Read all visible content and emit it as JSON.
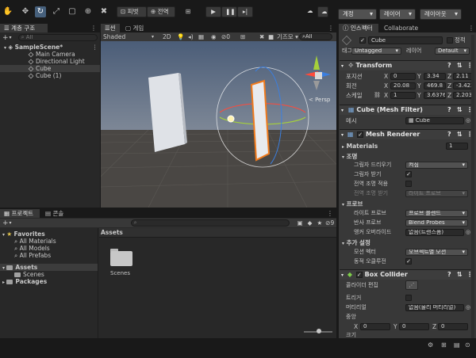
{
  "toolbar": {
    "pause_label": "피벗",
    "global_label": "전역",
    "account_label": "계정",
    "layers_label": "레이어",
    "layout_label": "레이아웃"
  },
  "hierarchy": {
    "tab_label": "계층 구조",
    "search_placeholder": "All",
    "scene_name": "SampleScene*",
    "items": [
      "Main Camera",
      "Directional Light",
      "Cube",
      "Cube (1)"
    ]
  },
  "scene_view": {
    "tab_scene": "씬",
    "tab_game": "게임",
    "shading": "Shaded",
    "mode_2d": "2D",
    "hidden_count": "0",
    "gizmos_label": "기즈모",
    "persp_label": "< Persp"
  },
  "project": {
    "tab_project": "프로젝트",
    "tab_console": "콘솔",
    "hidden_count": "9",
    "favorites_label": "Favorites",
    "favorites": [
      "All Materials",
      "All Models",
      "All Prefabs"
    ],
    "assets_label": "Assets",
    "assets_children": [
      "Scenes"
    ],
    "packages_label": "Packages",
    "breadcrumb": "Assets",
    "folder_name": "Scenes"
  },
  "inspector": {
    "tab_inspector": "인스펙터",
    "tab_collaborate": "Collaborate",
    "object_name": "Cube",
    "static_label": "정적",
    "tag_label": "태그",
    "tag_value": "Untagged",
    "layer_label": "레이어",
    "layer_value": "Default",
    "transform": {
      "title": "Transform",
      "position_label": "포지션",
      "rotation_label": "회전",
      "scale_label": "스케일",
      "position": [
        "0",
        "3.34",
        "2.11"
      ],
      "rotation": [
        "20.08",
        "469.8",
        "-3.422"
      ],
      "scale": [
        "1",
        "3.6376",
        "2.203"
      ]
    },
    "mesh_filter": {
      "title": "Cube (Mesh Filter)",
      "mesh_label": "메시",
      "mesh_value": "Cube"
    },
    "mesh_renderer": {
      "title": "Mesh Renderer",
      "materials_label": "Materials",
      "materials_count": "1",
      "lighting_label": "조명",
      "cast_shadows_label": "그림자 드리우기",
      "cast_shadows_value": "켜짐",
      "receive_shadows_label": "그림자 받기",
      "contribute_gi_label": "전역 조명 적용",
      "receive_gi_label": "전역 조명 받기",
      "receive_gi_value": "라이트 프로브",
      "probes_label": "프로브",
      "light_probes_label": "라이트 프로브",
      "light_probes_value": "프로브 블렌드",
      "reflection_probes_label": "반사 프로브",
      "reflection_probes_value": "Blend Probes",
      "anchor_override_label": "앵커 오버라이드",
      "anchor_override_value": "없음(트랜스폼)",
      "additional_label": "추가 설정",
      "motion_vectors_label": "모션 벡터",
      "motion_vectors_value": "오브젝트별 모션",
      "dynamic_occlusion_label": "동적 오클루전"
    },
    "box_collider": {
      "title": "Box Collider",
      "edit_collider_label": "콜라이더 편집",
      "trigger_label": "트리거",
      "material_label": "머티리얼",
      "material_value": "없음(물리 머티리얼)",
      "center_label": "중앙",
      "center": [
        "0",
        "0",
        "0"
      ],
      "size_label": "크기"
    }
  },
  "colors": {
    "accent_selected": "#46607c",
    "selection_orange": "#f07a1c",
    "sky_top": "#4b5d78",
    "ground": "#4a4744"
  }
}
